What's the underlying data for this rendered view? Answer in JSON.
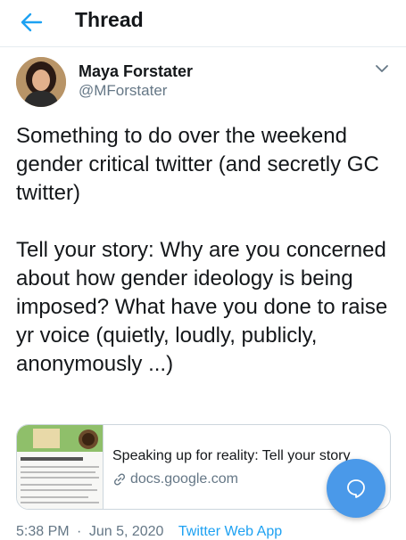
{
  "header": {
    "title": "Thread",
    "back_icon": "arrow-left-icon"
  },
  "tweet": {
    "author": {
      "display_name": "Maya Forstater",
      "handle": "@MForstater"
    },
    "text": "Something to do over the weekend gender critical twitter (and secretly GC twitter)\n\nTell your story: Why are you concerned about how gender ideology is being imposed? What have you done to raise yr voice (quietly, loudly, publicly, anonymously ...)",
    "link_card": {
      "title": "Speaking up for reality: Tell your story",
      "domain": "docs.google.com"
    },
    "meta": {
      "time": "5:38 PM",
      "separator": "·",
      "date": "Jun 5, 2020",
      "source": "Twitter Web App"
    }
  },
  "colors": {
    "accent": "#1da1f2",
    "fab": "#4a99e9",
    "secondary_text": "#657786"
  },
  "icons": {
    "caret": "chevron-down-icon",
    "link": "link-icon",
    "fab": "reply-bubble-icon"
  }
}
